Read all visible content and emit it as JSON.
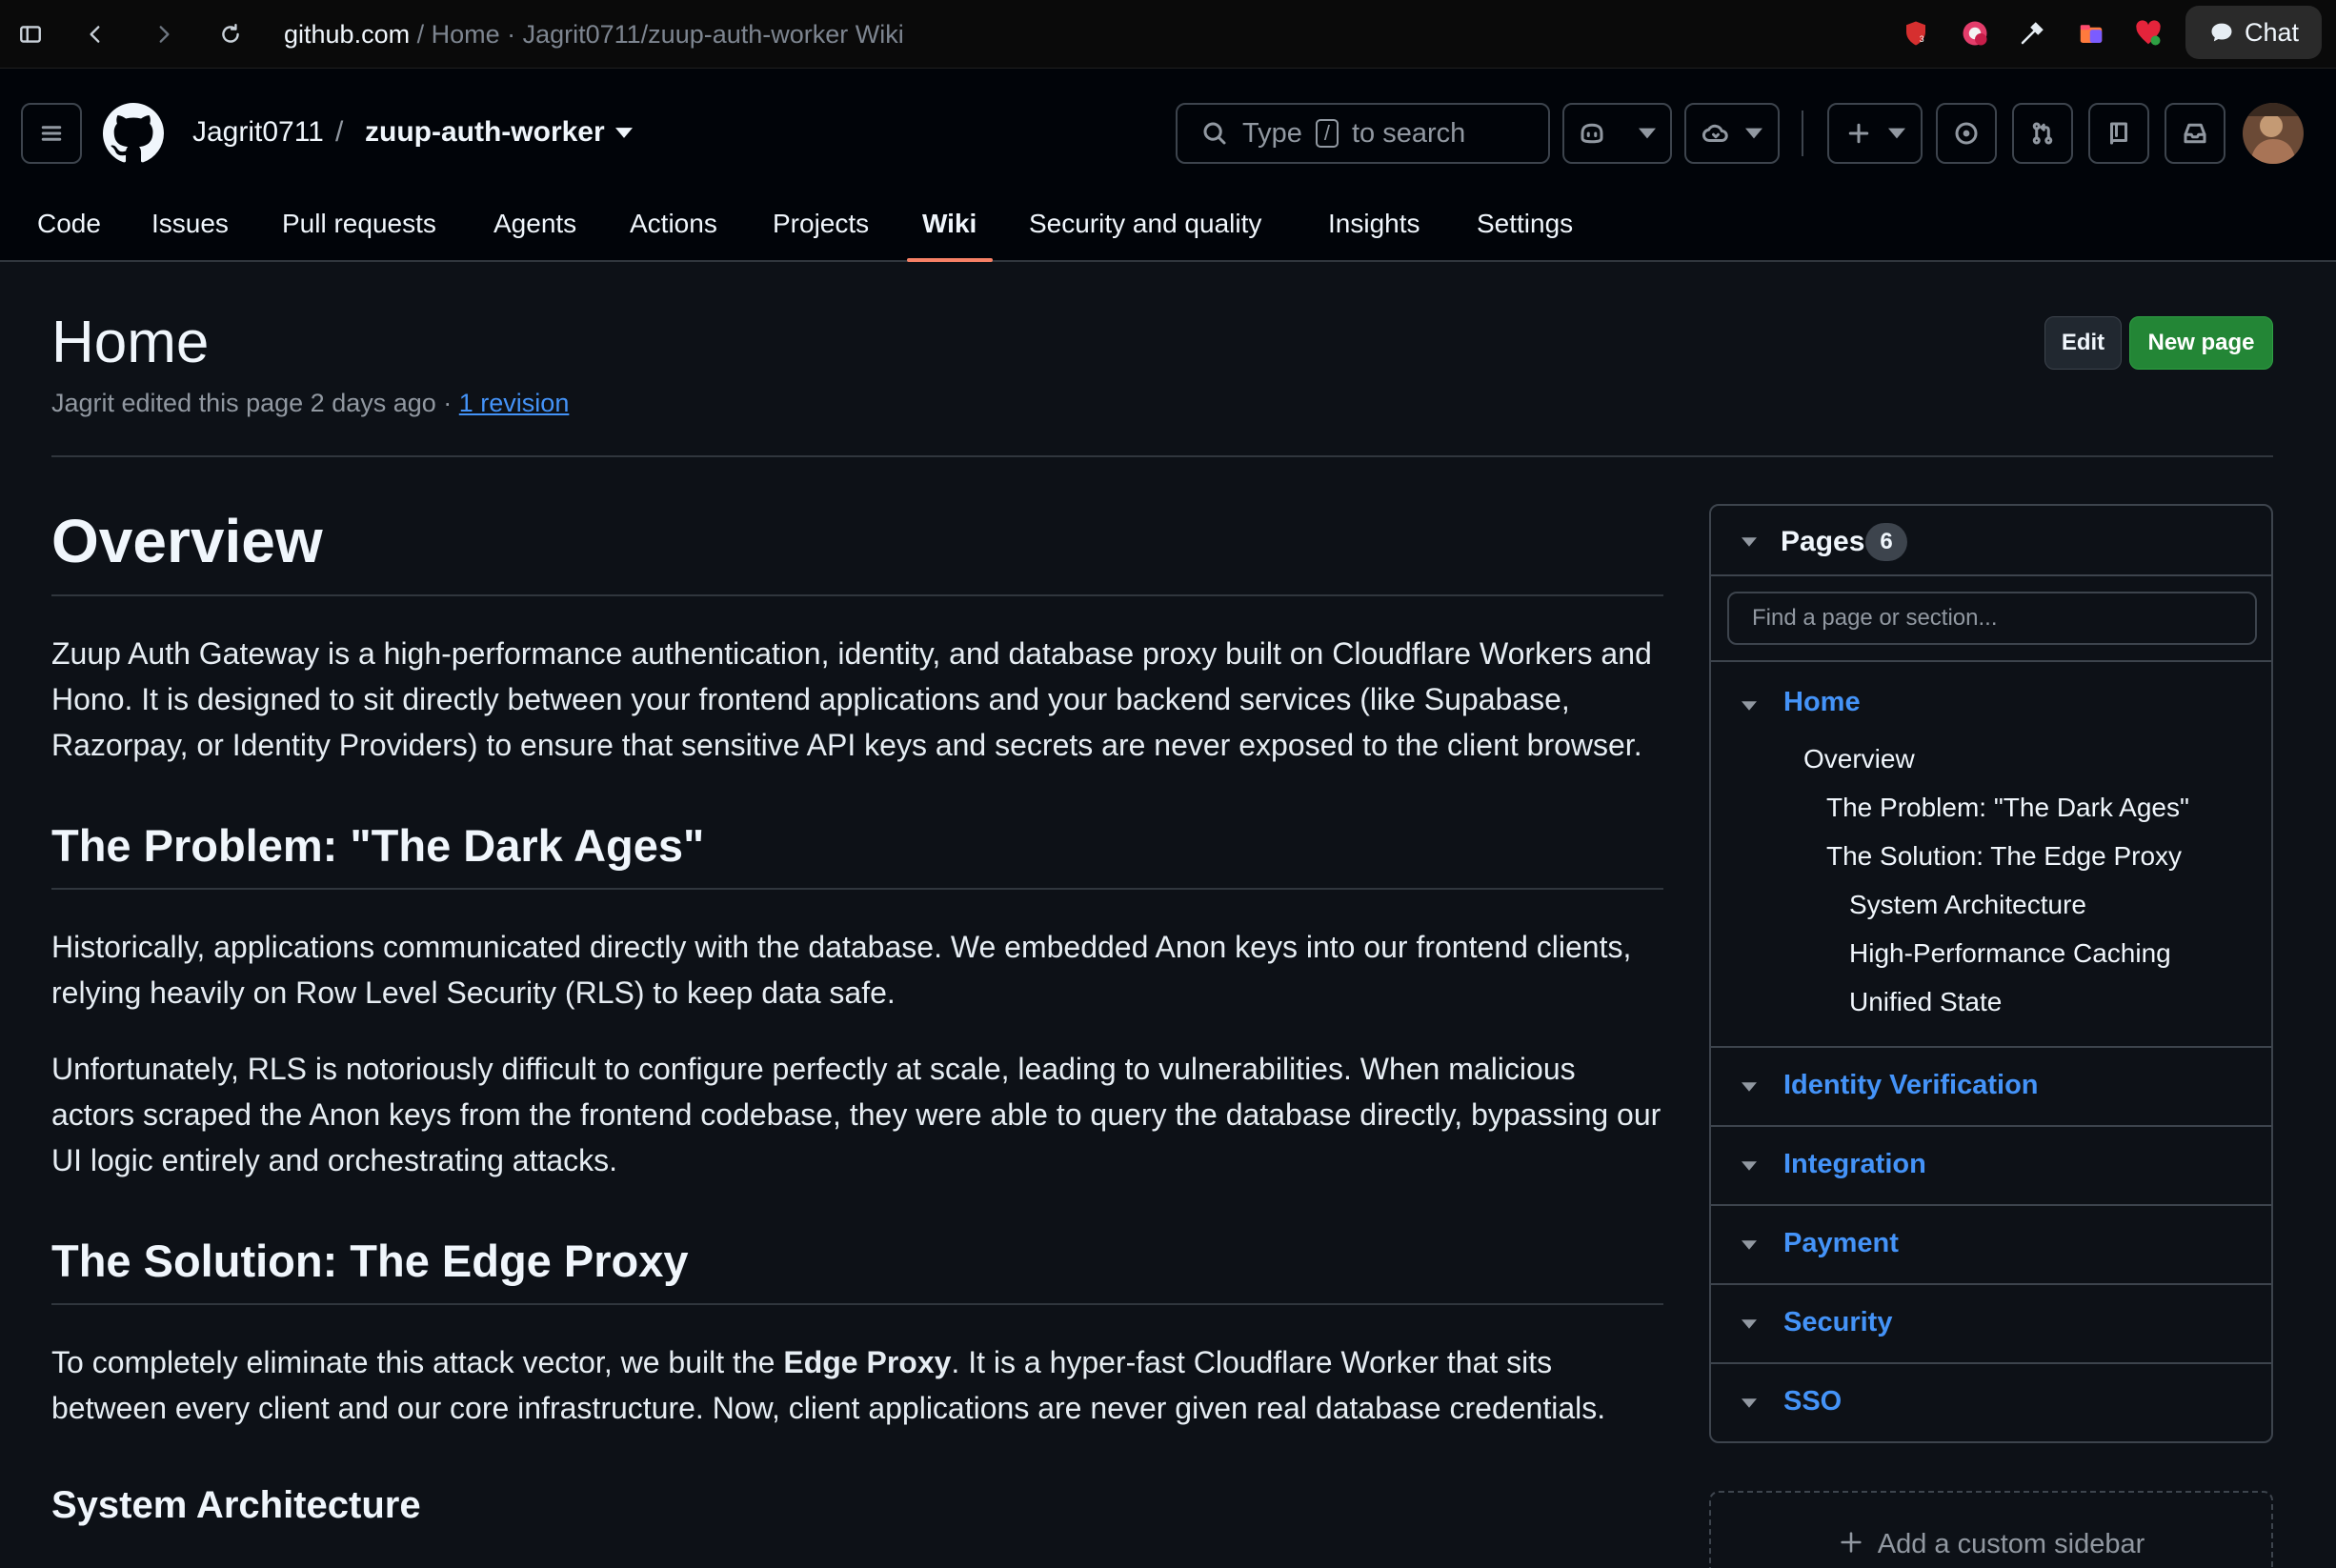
{
  "browser": {
    "host": "github.com",
    "path": " / Home · Jagrit0711/zuup-auth-worker Wiki",
    "chat_label": "Chat"
  },
  "header": {
    "owner": "Jagrit0711",
    "separator": "/",
    "repo": "zuup-auth-worker",
    "search_prefix": "Type",
    "search_key": "/",
    "search_suffix": "to search"
  },
  "tabs": [
    {
      "label": "Code"
    },
    {
      "label": "Issues"
    },
    {
      "label": "Pull requests"
    },
    {
      "label": "Agents"
    },
    {
      "label": "Actions"
    },
    {
      "label": "Projects"
    },
    {
      "label": "Wiki"
    },
    {
      "label": "Security and quality"
    },
    {
      "label": "Insights"
    },
    {
      "label": "Settings"
    }
  ],
  "page": {
    "title": "Home",
    "meta_text": "Jagrit edited this page 2 days ago · ",
    "revision_link": "1 revision",
    "edit_label": "Edit",
    "new_page_label": "New page"
  },
  "article": {
    "h1": "Overview",
    "p1": "Zuup Auth Gateway is a high-performance authentication, identity, and database proxy built on Cloudflare Workers and Hono. It is designed to sit directly between your frontend applications and your backend services (like Supabase, Razorpay, or Identity Providers) to ensure that sensitive API keys and secrets are never exposed to the client browser.",
    "h2_problem": "The Problem: \"The Dark Ages\"",
    "p2": "Historically, applications communicated directly with the database. We embedded Anon keys into our frontend clients, relying heavily on Row Level Security (RLS) to keep data safe.",
    "p3": "Unfortunately, RLS is notoriously difficult to configure perfectly at scale, leading to vulnerabilities. When malicious actors scraped the Anon keys from the frontend codebase, they were able to query the database directly, bypassing our UI logic entirely and orchestrating attacks.",
    "h2_solution": "The Solution: The Edge Proxy",
    "p4_pre": "To completely eliminate this attack vector, we built the ",
    "p4_bold": "Edge Proxy",
    "p4_post": ". It is a hyper-fast Cloudflare Worker that sits between every client and our core infrastructure. Now, client applications are never given real database credentials.",
    "h3_arch": "System Architecture"
  },
  "sidebar": {
    "pages_label": "Pages",
    "pages_count": "6",
    "find_placeholder": "Find a page or section...",
    "home_label": "Home",
    "toc": [
      "Overview",
      "The Problem: \"The Dark Ages\"",
      "The Solution: The Edge Proxy",
      "System Architecture",
      "High-Performance Caching",
      "Unified State"
    ],
    "other_pages": [
      "Identity Verification",
      "Integration",
      "Payment",
      "Security",
      "SSO"
    ],
    "custom_sidebar_label": "Add a custom sidebar"
  }
}
